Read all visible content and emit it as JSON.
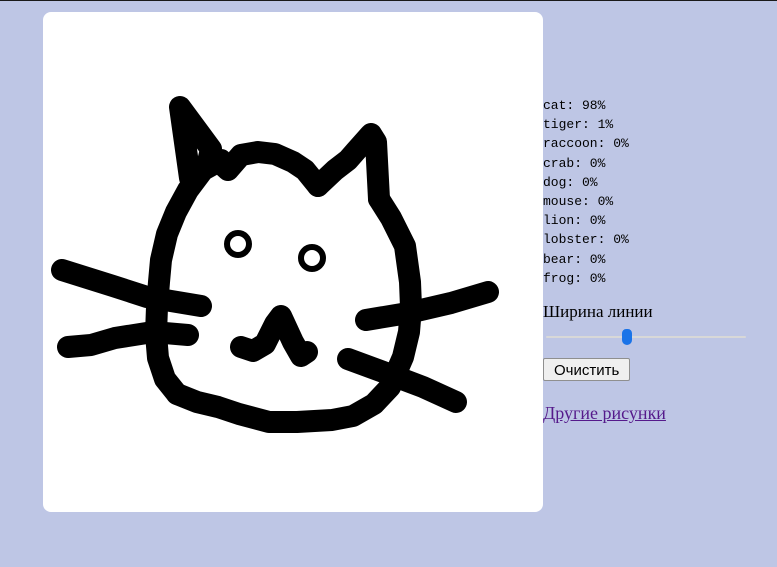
{
  "predictions": [
    {
      "label": "cat",
      "percent": "98%",
      "text": "cat: 98%"
    },
    {
      "label": "tiger",
      "percent": "1%",
      "text": "tiger: 1%"
    },
    {
      "label": "raccoon",
      "percent": "0%",
      "text": "raccoon: 0%"
    },
    {
      "label": "crab",
      "percent": "0%",
      "text": "crab: 0%"
    },
    {
      "label": "dog",
      "percent": "0%",
      "text": "dog: 0%"
    },
    {
      "label": "mouse",
      "percent": "0%",
      "text": "mouse: 0%"
    },
    {
      "label": "lion",
      "percent": "0%",
      "text": "lion: 0%"
    },
    {
      "label": "lobster",
      "percent": "0%",
      "text": "lobster: 0%"
    },
    {
      "label": "bear",
      "percent": "0%",
      "text": "bear: 0%"
    },
    {
      "label": "frog",
      "percent": "0%",
      "text": "frog: 0%"
    }
  ],
  "controls": {
    "line_width_label": "Ширина линии",
    "line_width_fraction": 0.4,
    "clear_button_label": "Очистить",
    "other_drawings_link": "Другие рисунки"
  },
  "colors": {
    "page_background": "#bec6e5",
    "canvas_background": "#ffffff",
    "stroke": "#000000",
    "slider_accent": "#1a73e8",
    "link_visited": "#551a8b"
  }
}
